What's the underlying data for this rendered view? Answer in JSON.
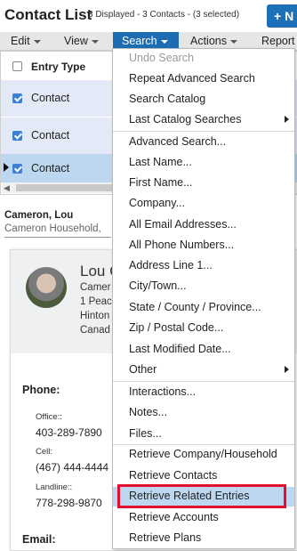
{
  "header": {
    "title": "Contact List",
    "subtitle": "3 Displayed - 3 Contacts - (3 selected)",
    "new_label": "+ N"
  },
  "menubar": {
    "items": [
      "Edit",
      "View",
      "Search",
      "Actions",
      "Report"
    ],
    "active": "Search"
  },
  "grid": {
    "column": "Entry Type",
    "rows": [
      {
        "label": "Contact",
        "checked": true
      },
      {
        "label": "Contact",
        "checked": true
      },
      {
        "label": "Contact",
        "checked": true,
        "current": true
      }
    ]
  },
  "summary": {
    "name": "Cameron, Lou",
    "household": "Cameron Household,"
  },
  "detail": {
    "name": "Lou C",
    "address_lines": [
      "Camer",
      "1 Peac",
      "Hinton",
      "Canad"
    ],
    "phone_title": "Phone:",
    "phones": [
      {
        "label": "Office::",
        "value": "403-289-7890"
      },
      {
        "label": "Cell:",
        "value": "(467) 444-4444"
      },
      {
        "label": "Landline::",
        "value": "778-298-9870"
      }
    ],
    "email_title": "Email:"
  },
  "search_menu": {
    "items": [
      {
        "label": "Undo Search",
        "disabled": true
      },
      {
        "label": "Repeat Advanced Search"
      },
      {
        "label": "Search Catalog"
      },
      {
        "label": "Last Catalog Searches",
        "submenu": true
      },
      {
        "label": "Advanced Search..."
      },
      {
        "label": "Last Name..."
      },
      {
        "label": "First Name..."
      },
      {
        "label": "Company..."
      },
      {
        "label": "All Email Addresses..."
      },
      {
        "label": "All Phone Numbers..."
      },
      {
        "label": "Address Line 1..."
      },
      {
        "label": "City/Town..."
      },
      {
        "label": "State / County / Province..."
      },
      {
        "label": "Zip / Postal Code..."
      },
      {
        "label": "Last Modified Date..."
      },
      {
        "label": "Other",
        "submenu": true
      },
      {
        "label": "Interactions..."
      },
      {
        "label": "Notes..."
      },
      {
        "label": "Files..."
      },
      {
        "label": "Retrieve Company/Household"
      },
      {
        "label": "Retrieve Contacts"
      },
      {
        "label": "Retrieve Related Entries",
        "highlighted": true
      },
      {
        "label": "Retrieve Accounts"
      },
      {
        "label": "Retrieve Plans"
      }
    ]
  },
  "colors": {
    "accent": "#1e6db2",
    "highlight": "#bcd7ef",
    "annotation": "#e0102e"
  }
}
